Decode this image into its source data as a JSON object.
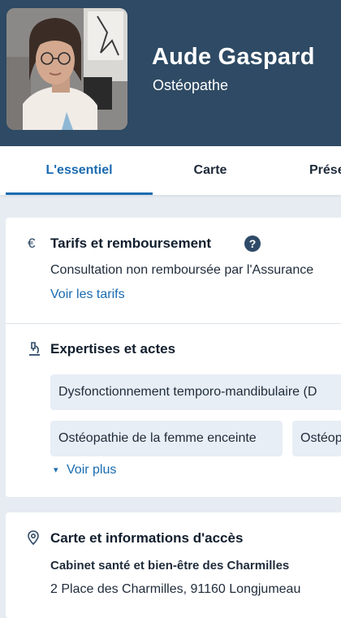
{
  "profile": {
    "name": "Aude Gaspard",
    "specialty": "Ostéopathe"
  },
  "tabs": [
    {
      "label": "L'essentiel",
      "active": true
    },
    {
      "label": "Carte",
      "active": false
    },
    {
      "label": "Prése",
      "active": false
    }
  ],
  "tarifs": {
    "icon": "euro-icon",
    "icon_glyph": "€",
    "title": "Tarifs et remboursement",
    "help_glyph": "?",
    "text": "Consultation non remboursée par l'Assurance",
    "link": "Voir les tarifs"
  },
  "expertises": {
    "icon": "microscope-icon",
    "title": "Expertises et actes",
    "chips": [
      "Dysfonctionnement temporo-mandibulaire (D",
      "Ostéopathie de la femme enceinte",
      "Ostéop"
    ],
    "more_arrow": "▾",
    "more_label": "Voir plus"
  },
  "acces": {
    "icon": "location-pin-icon",
    "title": "Carte et informations d'accès",
    "place_name": "Cabinet santé et bien-être des Charmilles",
    "address": "2 Place des Charmilles, 91160 Longjumeau"
  },
  "colors": {
    "header_bg": "#2e4a64",
    "accent": "#1a6bb0",
    "page_bg": "#e6ecf2",
    "chip_bg": "#e8eef5"
  }
}
